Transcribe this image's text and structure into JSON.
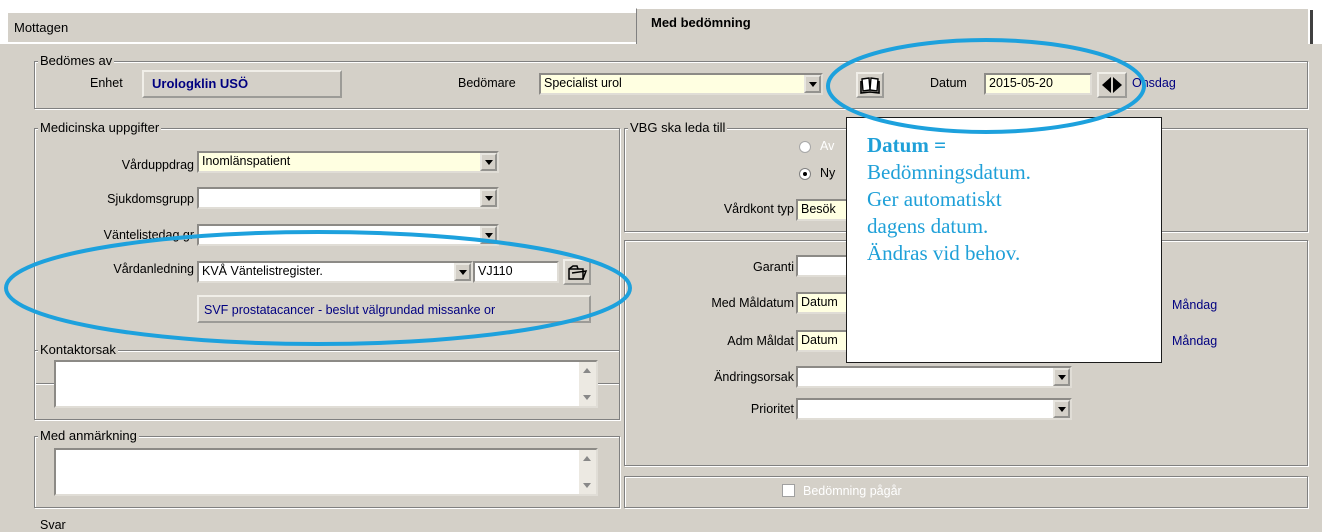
{
  "tabs": [
    {
      "label": "Mottagen",
      "active": false
    },
    {
      "label": "Med bedömning",
      "active": true
    }
  ],
  "bedomes_av": {
    "legend": "Bedömes av",
    "enhet_label": "Enhet",
    "enhet_value": "Urologklin USÖ",
    "bedomare_label": "Bedömare",
    "bedomare_value": "Specialist urol",
    "datum_label": "Datum",
    "datum_value": "2015-05-20",
    "weekday": "Onsdag"
  },
  "medicinska": {
    "legend": "Medicinska uppgifter",
    "vardupdrag_label": "Vårduppdrag",
    "vardupdrag_value": "Inomlänspatient",
    "sjukdomsgrupp_label": "Sjukdomsgrupp",
    "sjukdomsgrupp_value": "",
    "vantelistedag_label": "Väntelistedag gr",
    "vantelistedag_value": "",
    "vardanledning_label": "Vårdanledning",
    "vardanledning_value": "KVÅ Väntelistregister.",
    "vardanledning_code": "VJ110",
    "svf_button": "SVF prostatacancer - beslut välgrundad missanke or"
  },
  "kontaktorsak": {
    "legend": "Kontaktorsak",
    "value": ""
  },
  "anmarkning": {
    "legend": "Med anmärkning",
    "value": ""
  },
  "vbg": {
    "legend": "VBG ska leda till",
    "radio1": "Av",
    "radio2": "Ny",
    "vardkont_label": "Vårdkont typ",
    "vardkont_value": "Besök"
  },
  "garanti": {
    "garanti_label": "Garanti",
    "med_maldatum_label": "Med Måldatum",
    "med_maldatum_value": "Datum",
    "med_maldatum_day": "Måndag",
    "adm_maldat_label": "Adm Måldat",
    "adm_maldat_value": "Datum",
    "adm_maldat_day": "Måndag",
    "andringsorsak_label": "Ändringsorsak",
    "prioritet_label": "Prioritet"
  },
  "bedomning_pagar": "Bedömning pågår",
  "status_bottom": "Svar",
  "callout": {
    "title": "Datum =",
    "body": "Bedömningsdatum.\nGer automatiskt\ndagens datum.\nÄndras vid behov."
  },
  "colors": {
    "highlight_ellipse": "#1da1dd",
    "callout_text": "#1fa0d8",
    "field_yellow": "#ffffe1",
    "window_bg": "#d4d0c8"
  }
}
